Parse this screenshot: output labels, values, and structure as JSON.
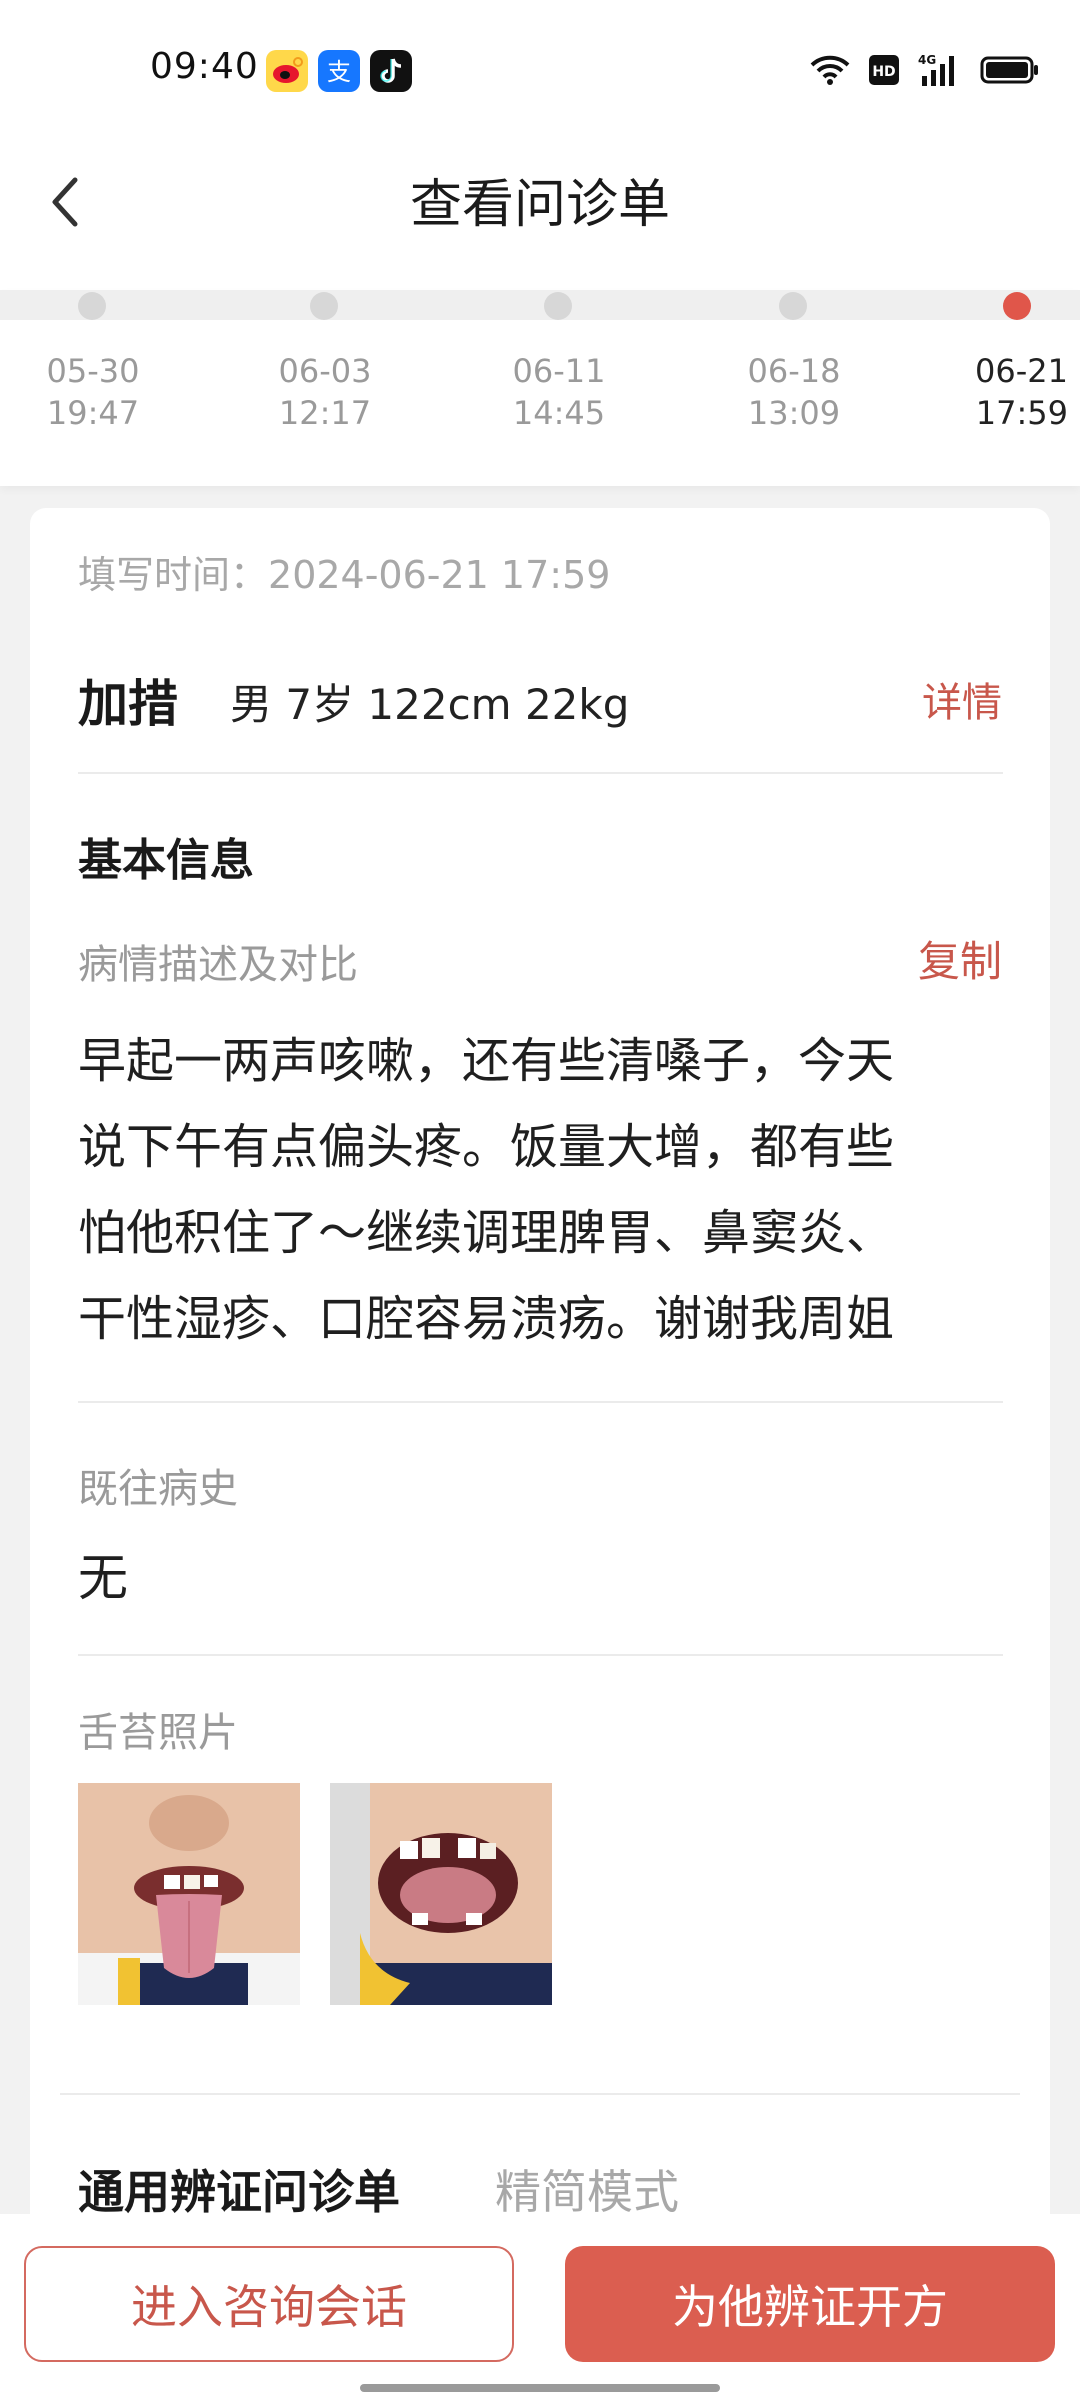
{
  "status_bar": {
    "time": "09:40",
    "apps": [
      "weibo-icon",
      "alipay-icon",
      "tiktok-icon"
    ],
    "indicators": [
      "wifi-icon",
      "hd-icon",
      "signal-4g-icon",
      "battery-icon"
    ]
  },
  "header": {
    "title": "查看问诊单",
    "back_icon": "back-arrow-icon"
  },
  "timeline": {
    "items": [
      {
        "date": "05-30",
        "time": "19:47",
        "active": false
      },
      {
        "date": "06-03",
        "time": "12:17",
        "active": false
      },
      {
        "date": "06-11",
        "time": "14:45",
        "active": false
      },
      {
        "date": "06-18",
        "time": "13:09",
        "active": false
      },
      {
        "date": "06-21",
        "time": "17:59",
        "active": true
      }
    ]
  },
  "record": {
    "fill_time_label": "填写时间：",
    "fill_time_value": "2024-06-21 17:59",
    "patient_name": "加措",
    "patient_info": "男 7岁 122cm 22kg",
    "detail_link": "详情",
    "basic_info_title": "基本信息",
    "description_label": "病情描述及对比",
    "copy_link": "复制",
    "description_lines": [
      "早起一两声咳嗽，还有些清嗓子，今天",
      "说下午有点偏头疼。饭量大增，都有些",
      "怕他积住了～继续调理脾胃、鼻窦炎、",
      "干性湿疹、口腔容易溃疡。谢谢我周姐"
    ],
    "history_label": "既往病史",
    "history_value": "无",
    "tongue_photo_label": "舌苔照片"
  },
  "tabs": {
    "main": "通用辨证问诊单",
    "alt": "精简模式"
  },
  "actions": {
    "consult_button": "进入咨询会话",
    "prescribe_button": "为他辨证开方"
  },
  "colors": {
    "accent": "#db5e50",
    "link": "#c8574b",
    "active_dot": "#e0564a"
  }
}
